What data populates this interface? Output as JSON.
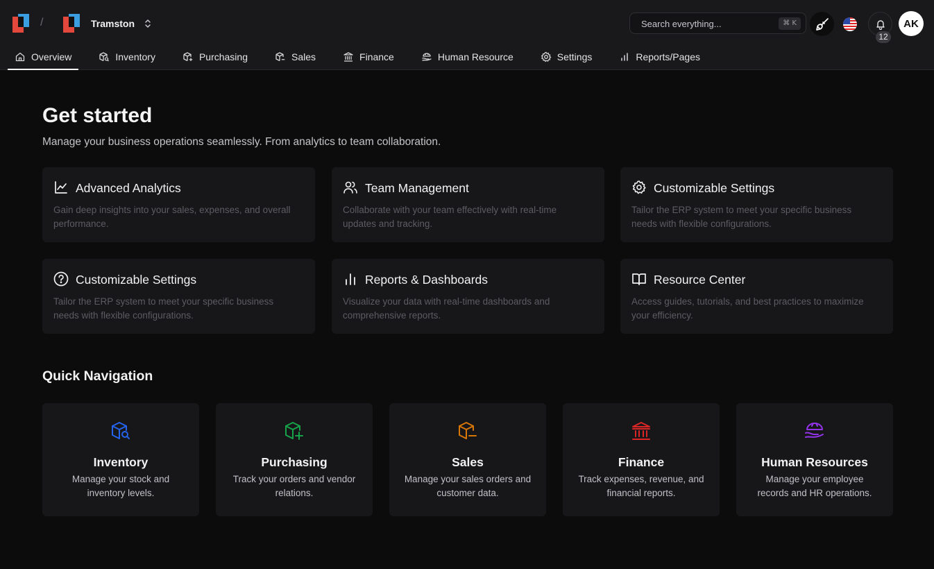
{
  "header": {
    "org_name": "Tramston",
    "search": {
      "placeholder": "Search everything...",
      "shortcut": "⌘ K"
    },
    "notification_count": "12",
    "avatar_initials": "AK"
  },
  "tabs": [
    {
      "label": "Overview",
      "icon": "home-icon",
      "active": true
    },
    {
      "label": "Inventory",
      "icon": "box-search-icon"
    },
    {
      "label": "Purchasing",
      "icon": "box-plus-icon"
    },
    {
      "label": "Sales",
      "icon": "box-minus-icon"
    },
    {
      "label": "Finance",
      "icon": "bank-icon"
    },
    {
      "label": "Human Resource",
      "icon": "hr-icon"
    },
    {
      "label": "Settings",
      "icon": "gear-icon"
    },
    {
      "label": "Reports/Pages",
      "icon": "bar-chart-icon"
    }
  ],
  "main": {
    "title": "Get started",
    "subtitle": "Manage your business operations seamlessly. From analytics to team collaboration.",
    "features": [
      {
        "title": "Advanced Analytics",
        "desc": "Gain deep insights into your sales, expenses, and overall performance.",
        "icon": "line-chart-icon"
      },
      {
        "title": "Team Management",
        "desc": "Collaborate with your team effectively with real-time updates and tracking.",
        "icon": "users-icon"
      },
      {
        "title": "Customizable Settings",
        "desc": "Tailor the ERP system to meet your specific business needs with flexible configurations.",
        "icon": "gear-icon"
      },
      {
        "title": "Customizable Settings",
        "desc": "Tailor the ERP system to meet your specific business needs with flexible configurations.",
        "icon": "help-circle-icon"
      },
      {
        "title": "Reports & Dashboards",
        "desc": "Visualize your data with real-time dashboards and comprehensive reports.",
        "icon": "bar-chart-icon"
      },
      {
        "title": "Resource Center",
        "desc": "Access guides, tutorials, and best practices to maximize your efficiency.",
        "icon": "book-open-icon"
      }
    ],
    "quick_nav_title": "Quick Navigation",
    "quick_nav": [
      {
        "name": "Inventory",
        "desc": "Manage your stock and inventory levels.",
        "icon": "box-search-icon",
        "color": "#2563eb"
      },
      {
        "name": "Purchasing",
        "desc": "Track your orders and vendor relations.",
        "icon": "box-plus-icon",
        "color": "#16a34a"
      },
      {
        "name": "Sales",
        "desc": "Manage your sales orders and customer data.",
        "icon": "box-minus-icon",
        "color": "#d97706"
      },
      {
        "name": "Finance",
        "desc": "Track expenses, revenue, and financial reports.",
        "icon": "bank-icon",
        "color": "#dc2626"
      },
      {
        "name": "Human Resources",
        "desc": "Manage your employee records and HR operations.",
        "icon": "hr-icon",
        "color": "#9333ea"
      }
    ]
  }
}
